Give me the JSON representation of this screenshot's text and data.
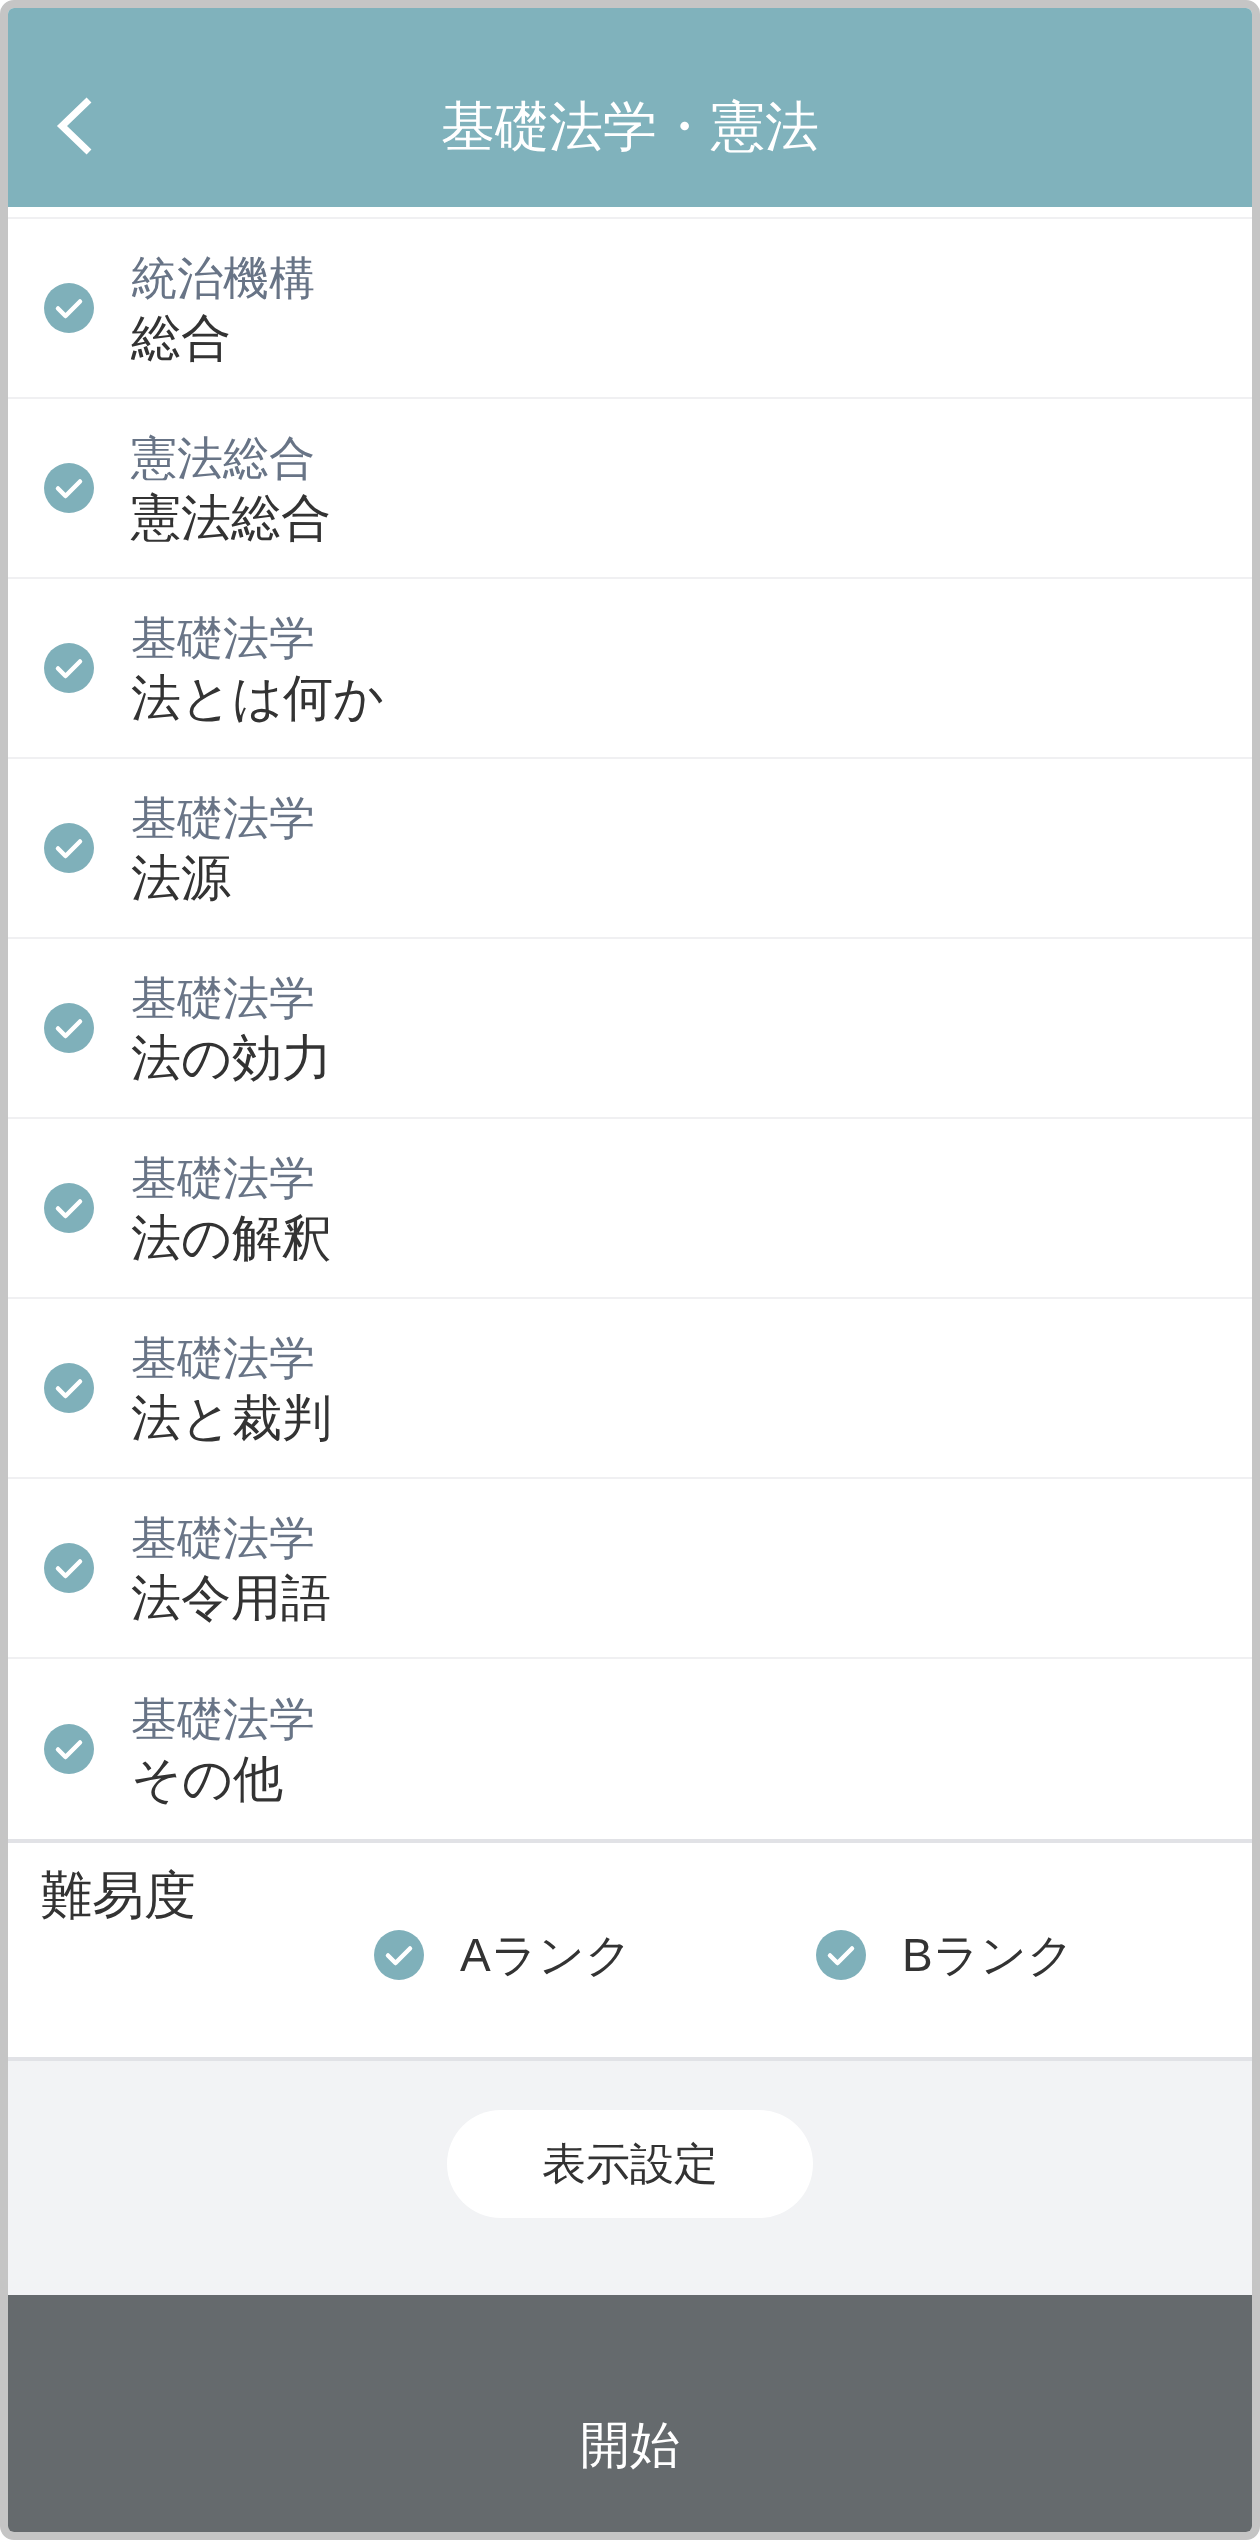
{
  "header": {
    "title": "基礎法学・憲法"
  },
  "topics": [
    {
      "category": "統治機構",
      "name": "総合",
      "checked": true
    },
    {
      "category": "憲法総合",
      "name": "憲法総合",
      "checked": true
    },
    {
      "category": "基礎法学",
      "name": "法とは何か",
      "checked": true
    },
    {
      "category": "基礎法学",
      "name": "法源",
      "checked": true
    },
    {
      "category": "基礎法学",
      "name": "法の効力",
      "checked": true
    },
    {
      "category": "基礎法学",
      "name": "法の解釈",
      "checked": true
    },
    {
      "category": "基礎法学",
      "name": "法と裁判",
      "checked": true
    },
    {
      "category": "基礎法学",
      "name": "法令用語",
      "checked": true
    },
    {
      "category": "基礎法学",
      "name": "その他",
      "checked": true
    }
  ],
  "difficulty": {
    "label": "難易度",
    "options": [
      {
        "label": "Aランク",
        "checked": true
      },
      {
        "label": "Bランク",
        "checked": true
      }
    ]
  },
  "display_settings_button": {
    "label": "表示設定"
  },
  "start_button": {
    "label": "開始"
  }
}
